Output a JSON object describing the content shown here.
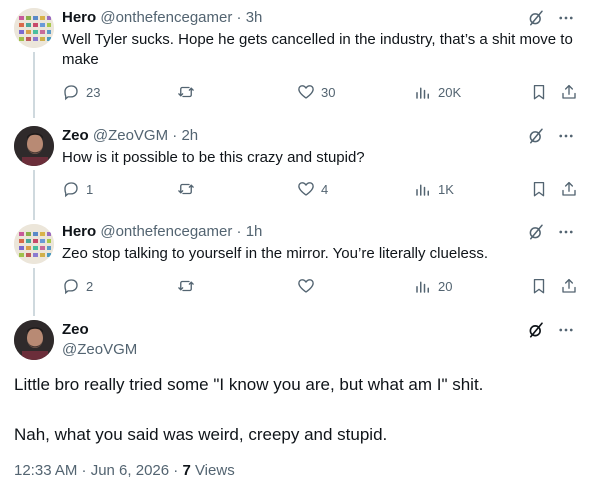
{
  "replies": [
    {
      "name": "Hero",
      "handle": "@onthefencegamer",
      "time": "3h",
      "text": "Well Tyler sucks. Hope he gets cancelled in the industry, that’s a shit move to make",
      "replies": "23",
      "reposts": "",
      "likes": "30",
      "views": "20K"
    },
    {
      "name": "Zeo",
      "handle": "@ZeoVGM",
      "time": "2h",
      "text": "How is it possible to be this crazy and stupid?",
      "replies": "1",
      "reposts": "",
      "likes": "4",
      "views": "1K"
    },
    {
      "name": "Hero",
      "handle": "@onthefencegamer",
      "time": "1h",
      "text": "Zeo stop talking to yourself in the mirror. You’re literally clueless.",
      "replies": "2",
      "reposts": "",
      "likes": "",
      "views": "20"
    }
  ],
  "focus": {
    "name": "Zeo",
    "handle": "@ZeoVGM",
    "paragraph1": "Little bro really tried some \"I know you are, but what am I\" shit.",
    "paragraph2": "Nah, what you said was weird, creepy and stupid.",
    "timestamp": "12:33 AM · Jun 6, 2026 · ",
    "views_count": "7",
    "views_label": " Views"
  },
  "separator": " · ",
  "icons": {
    "grok": "grok-icon",
    "more": "more-icon",
    "reply": "reply-icon",
    "repost": "repost-icon",
    "like": "heart-icon",
    "views": "views-icon",
    "bookmark": "bookmark-icon",
    "share": "share-icon"
  },
  "colors": {
    "text": "#0f1419",
    "secondary": "#536471",
    "thread_line": "#cfd9de"
  }
}
